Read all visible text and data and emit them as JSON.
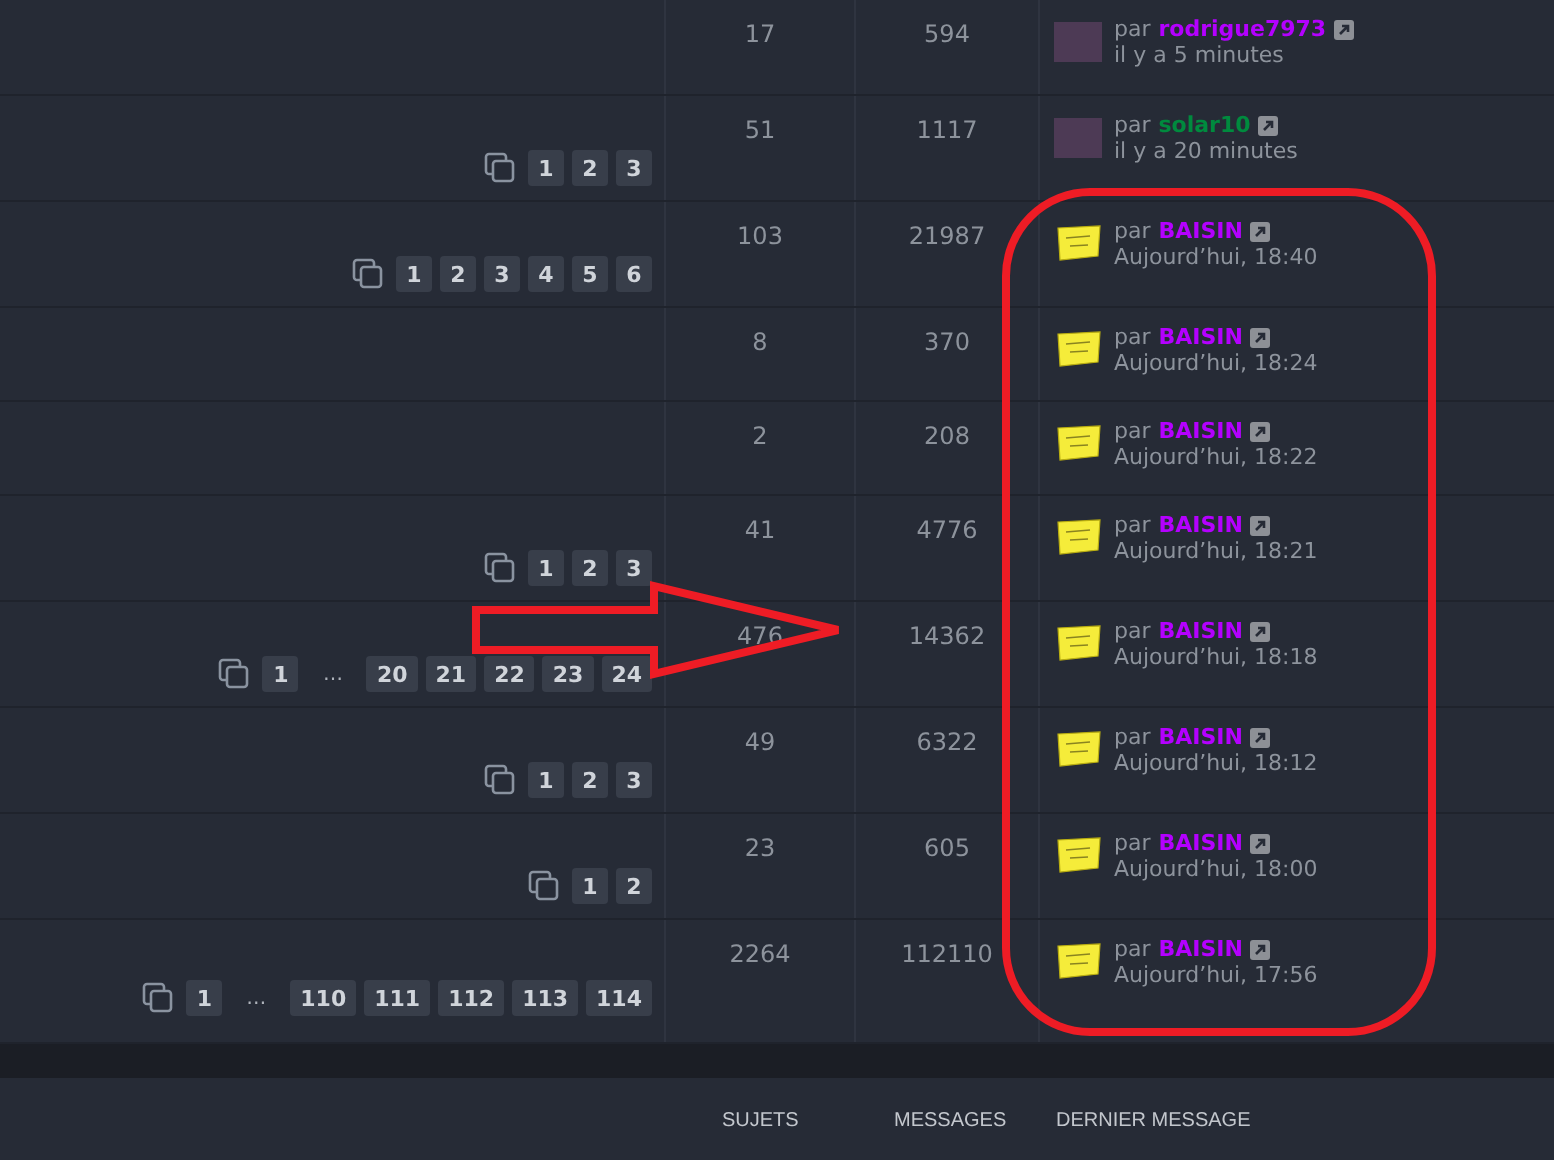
{
  "rows": [
    {
      "pages": [],
      "topics": "17",
      "messages": "594",
      "last": {
        "kind": "photo",
        "by": "par",
        "author": "rodrigue7973",
        "color": "#b400ff",
        "time": "il y a 5 minutes"
      }
    },
    {
      "pages": [
        {
          "kind": "page",
          "label": "1"
        },
        {
          "kind": "page",
          "label": "2"
        },
        {
          "kind": "page",
          "label": "3"
        }
      ],
      "topics": "51",
      "messages": "1117",
      "last": {
        "kind": "photo",
        "by": "par",
        "author": "solar10",
        "color": "#008a3e",
        "time": "il y a 20 minutes"
      }
    },
    {
      "pages": [
        {
          "kind": "page",
          "label": "1"
        },
        {
          "kind": "page",
          "label": "2"
        },
        {
          "kind": "page",
          "label": "3"
        },
        {
          "kind": "page",
          "label": "4"
        },
        {
          "kind": "page",
          "label": "5"
        },
        {
          "kind": "page",
          "label": "6"
        }
      ],
      "topics": "103",
      "messages": "21987",
      "last": {
        "kind": "note",
        "by": "par",
        "author": "BAISIN",
        "color": "#b400ff",
        "time": "Aujourd’hui, 18:40"
      }
    },
    {
      "pages": [],
      "topics": "8",
      "messages": "370",
      "last": {
        "kind": "note",
        "by": "par",
        "author": "BAISIN",
        "color": "#b400ff",
        "time": "Aujourd’hui, 18:24"
      }
    },
    {
      "pages": [],
      "topics": "2",
      "messages": "208",
      "last": {
        "kind": "note",
        "by": "par",
        "author": "BAISIN",
        "color": "#b400ff",
        "time": "Aujourd’hui, 18:22"
      }
    },
    {
      "pages": [
        {
          "kind": "page",
          "label": "1"
        },
        {
          "kind": "page",
          "label": "2"
        },
        {
          "kind": "page",
          "label": "3"
        }
      ],
      "topics": "41",
      "messages": "4776",
      "last": {
        "kind": "note",
        "by": "par",
        "author": "BAISIN",
        "color": "#b400ff",
        "time": "Aujourd’hui, 18:21"
      }
    },
    {
      "pages": [
        {
          "kind": "page",
          "label": "1"
        },
        {
          "kind": "ellipsis",
          "label": "…"
        },
        {
          "kind": "page",
          "label": "20"
        },
        {
          "kind": "page",
          "label": "21"
        },
        {
          "kind": "page",
          "label": "22"
        },
        {
          "kind": "page",
          "label": "23"
        },
        {
          "kind": "page",
          "label": "24"
        }
      ],
      "topics": "476",
      "messages": "14362",
      "last": {
        "kind": "note",
        "by": "par",
        "author": "BAISIN",
        "color": "#b400ff",
        "time": "Aujourd’hui, 18:18"
      }
    },
    {
      "pages": [
        {
          "kind": "page",
          "label": "1"
        },
        {
          "kind": "page",
          "label": "2"
        },
        {
          "kind": "page",
          "label": "3"
        }
      ],
      "topics": "49",
      "messages": "6322",
      "last": {
        "kind": "note",
        "by": "par",
        "author": "BAISIN",
        "color": "#b400ff",
        "time": "Aujourd’hui, 18:12"
      }
    },
    {
      "pages": [
        {
          "kind": "page",
          "label": "1"
        },
        {
          "kind": "page",
          "label": "2"
        }
      ],
      "topics": "23",
      "messages": "605",
      "last": {
        "kind": "note",
        "by": "par",
        "author": "BAISIN",
        "color": "#b400ff",
        "time": "Aujourd’hui, 18:00"
      }
    },
    {
      "pages": [
        {
          "kind": "page",
          "label": "1"
        },
        {
          "kind": "ellipsis",
          "label": "…"
        },
        {
          "kind": "page",
          "label": "110"
        },
        {
          "kind": "page",
          "label": "111"
        },
        {
          "kind": "page",
          "label": "112"
        },
        {
          "kind": "page",
          "label": "113"
        },
        {
          "kind": "page",
          "label": "114"
        }
      ],
      "topics": "2264",
      "messages": "112110",
      "last": {
        "kind": "note",
        "by": "par",
        "author": "BAISIN",
        "color": "#b400ff",
        "time": "Aujourd’hui, 17:56"
      }
    }
  ],
  "footer": {
    "columns": [
      "SUJETS",
      "MESSAGES",
      "DERNIER MESSAGE"
    ]
  }
}
